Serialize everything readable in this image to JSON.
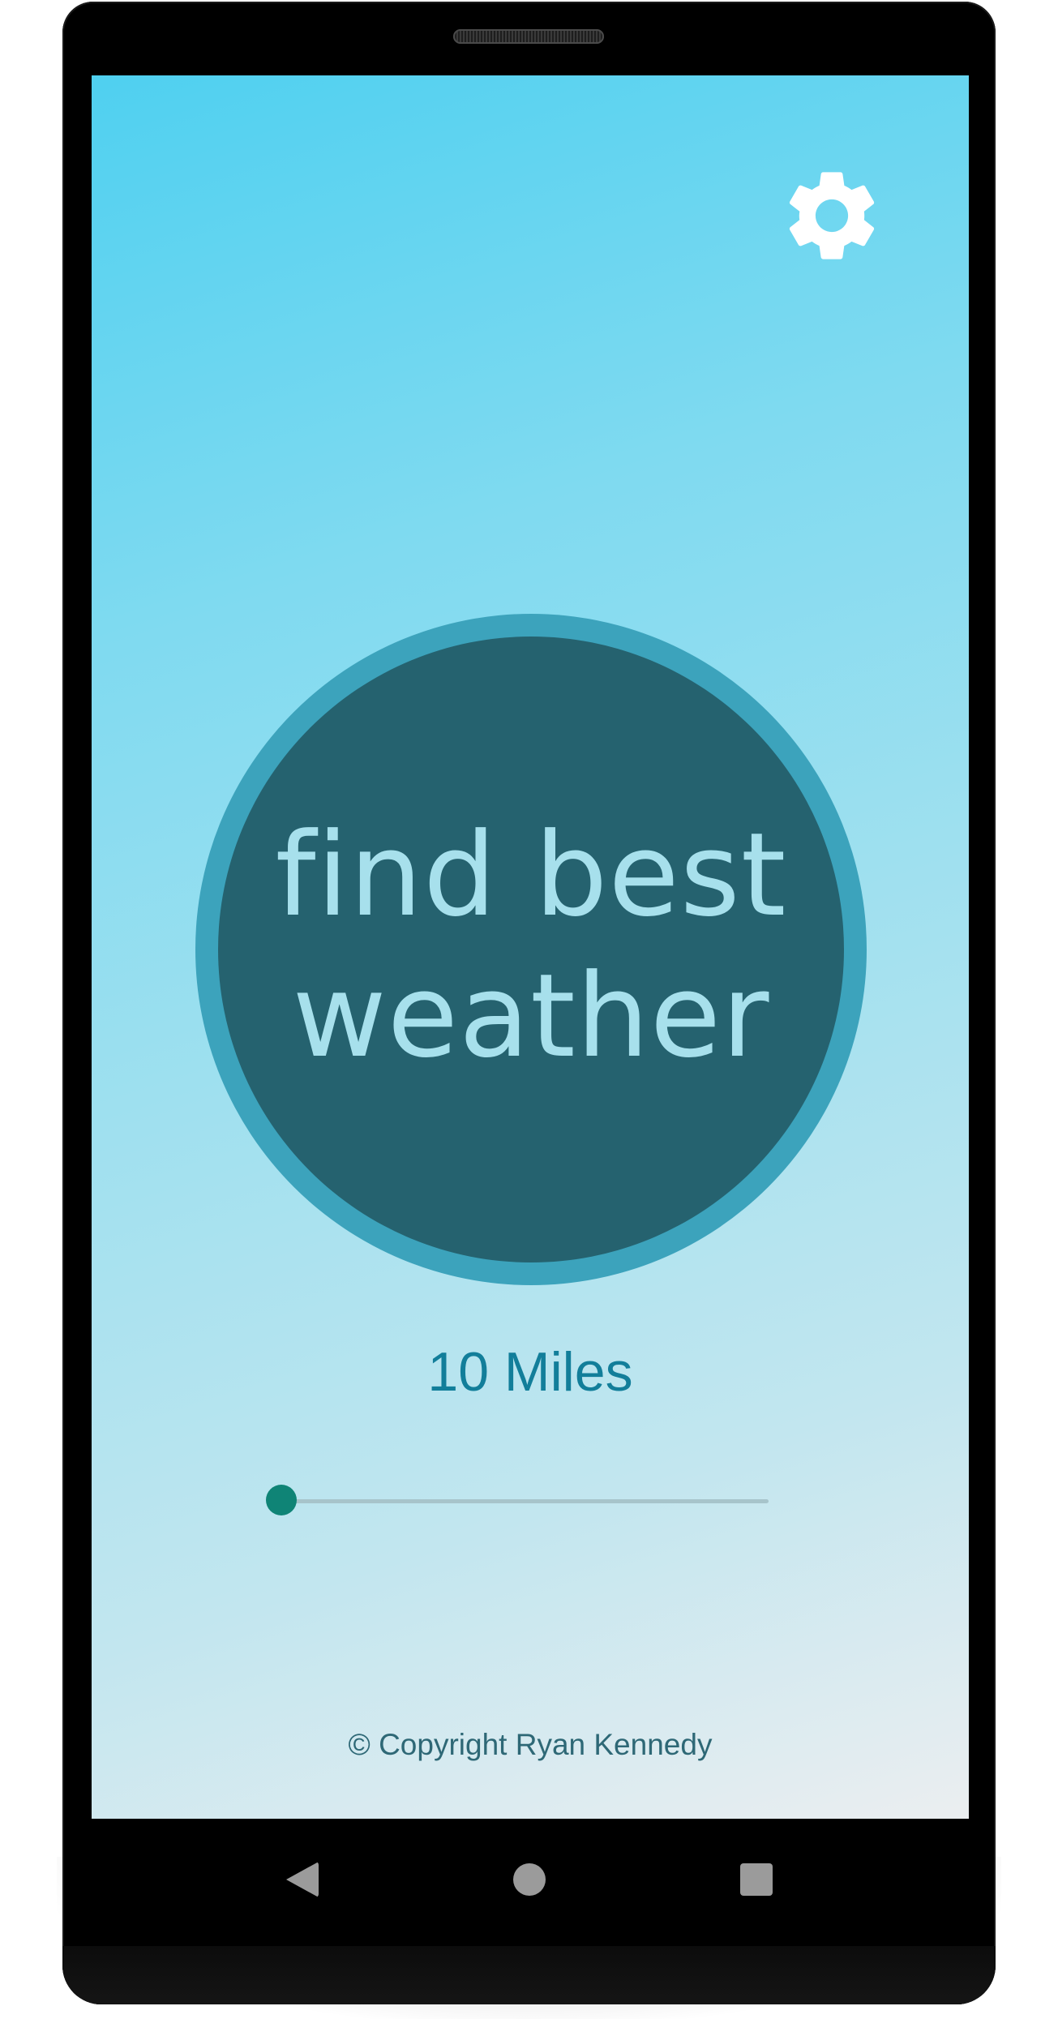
{
  "header": {
    "settings_icon": "gear-icon"
  },
  "main": {
    "button_line1": "find best",
    "button_line2": "weather",
    "distance_label": "10 Miles",
    "slider": {
      "value_fraction": 0.0
    }
  },
  "footer": {
    "copyright": "© Copyright Ryan Kennedy"
  },
  "navigation": {
    "back_icon": "back-triangle-icon",
    "home_icon": "home-circle-icon",
    "recents_icon": "recents-square-icon"
  },
  "colors": {
    "circle_fill": "#25626f",
    "circle_ring": "#3ca3bc",
    "circle_text": "#a7e0ec",
    "accent_text": "#127e9a",
    "slider_thumb": "#0f8476",
    "slider_track": "#a7c4cb",
    "gradient_top": "#4fd0f0",
    "gradient_bottom": "#ebeef0"
  }
}
